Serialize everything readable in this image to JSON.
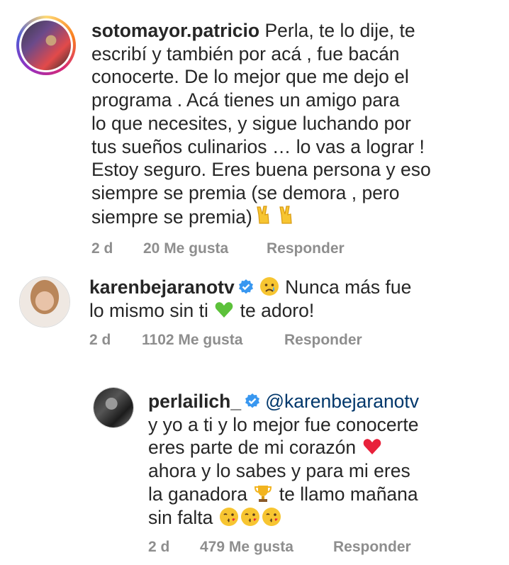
{
  "comments": [
    {
      "username": "sotomayor.patricio",
      "verified": false,
      "text_lines": [
        "Perla, te lo dije, te",
        "escribí y también por acá , fue bacán",
        "conocerte. De lo mejor que me dejo el",
        "programa . Acá tienes un amigo para",
        "lo que necesites, y sigue luchando por",
        "tus sueños culinarios … lo vas a lograr !",
        "Estoy seguro. Eres buena persona y eso",
        "siempre se premia (se demora , pero",
        "siempre se premia)"
      ],
      "emoji_after": "victory-hand x2",
      "time": "2 d",
      "likes": "20 Me gusta",
      "reply": "Responder"
    },
    {
      "username": "karenbejaranotv",
      "verified": true,
      "text_line1": "Nunca más fue",
      "text_line2a": "lo mismo sin ti",
      "text_line2b": "te adoro!",
      "emoji_before": "crying-face",
      "emoji_mid": "green-heart",
      "time": "2 d",
      "likes": "1102 Me gusta",
      "reply": "Responder"
    },
    {
      "username": "perlailich_",
      "verified": true,
      "mention": "@karenbejaranotv",
      "line1": "y yo a ti y lo mejor fue conocerte",
      "line2": "eres parte de mi corazón",
      "line3": "ahora y lo sabes y para mi eres",
      "line4a": "la ganadora",
      "line4b": "te llamo mañana",
      "line5": "sin falta",
      "emojis": [
        "red-heart",
        "trophy",
        "kissing-face x3"
      ],
      "time": "2 d",
      "likes": "479 Me gusta",
      "reply": "Responder"
    }
  ],
  "colors": {
    "text": "#262626",
    "meta": "#8e8e8e",
    "mention": "#00376b",
    "verified": "#3897f0"
  }
}
